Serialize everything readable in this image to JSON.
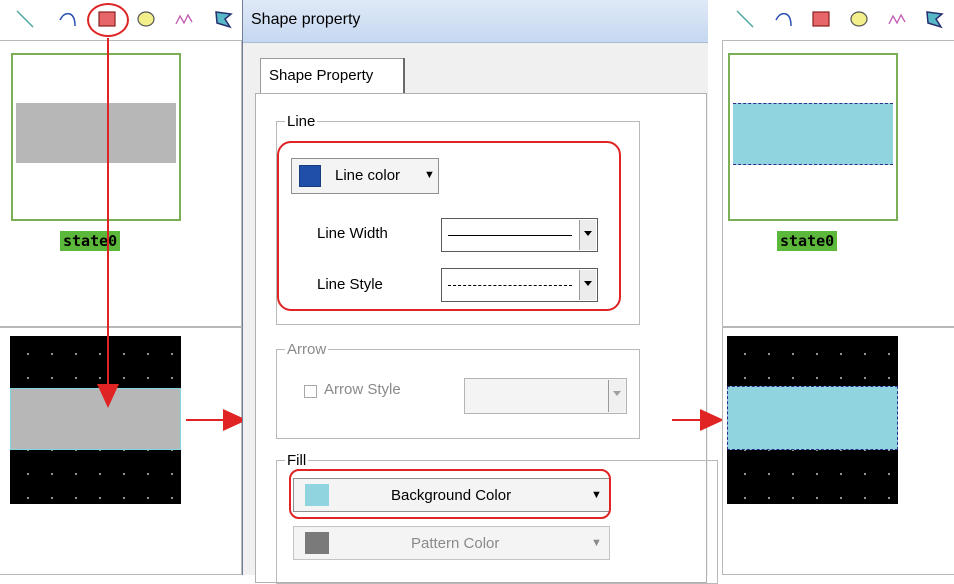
{
  "dialog": {
    "title": "Shape property",
    "tab_label": "Shape Property",
    "line_group": {
      "legend": "Line",
      "color_button_label": "Line color",
      "color_swatch": "#1f4fa8",
      "width_label": "Line Width",
      "style_label": "Line Style"
    },
    "arrow_group": {
      "legend": "Arrow",
      "checkbox_label": "Arrow Style",
      "checked": false
    },
    "fill_group": {
      "legend": "Fill",
      "background_button_label": "Background Color",
      "background_swatch": "#8fd4de",
      "pattern_button_label": "Pattern Color",
      "pattern_swatch": "#7a7a7a"
    }
  },
  "toolbar": {
    "tools": [
      "line-icon",
      "arc-icon",
      "rectangle-icon",
      "ellipse-icon",
      "polyline-icon",
      "polygon-icon"
    ],
    "highlighted_tool": "rectangle-icon"
  },
  "left_canvas": {
    "state_label": "state0",
    "shape_fill": "#b7b7b7"
  },
  "right_canvas": {
    "state_label": "state0",
    "shape_fill": "#8fd4de",
    "shape_border": "dashed #2c2c8a"
  },
  "colors": {
    "annotation": "#e02424",
    "state_frame": "#7cae55",
    "state_label_bg": "#5cb83a"
  }
}
